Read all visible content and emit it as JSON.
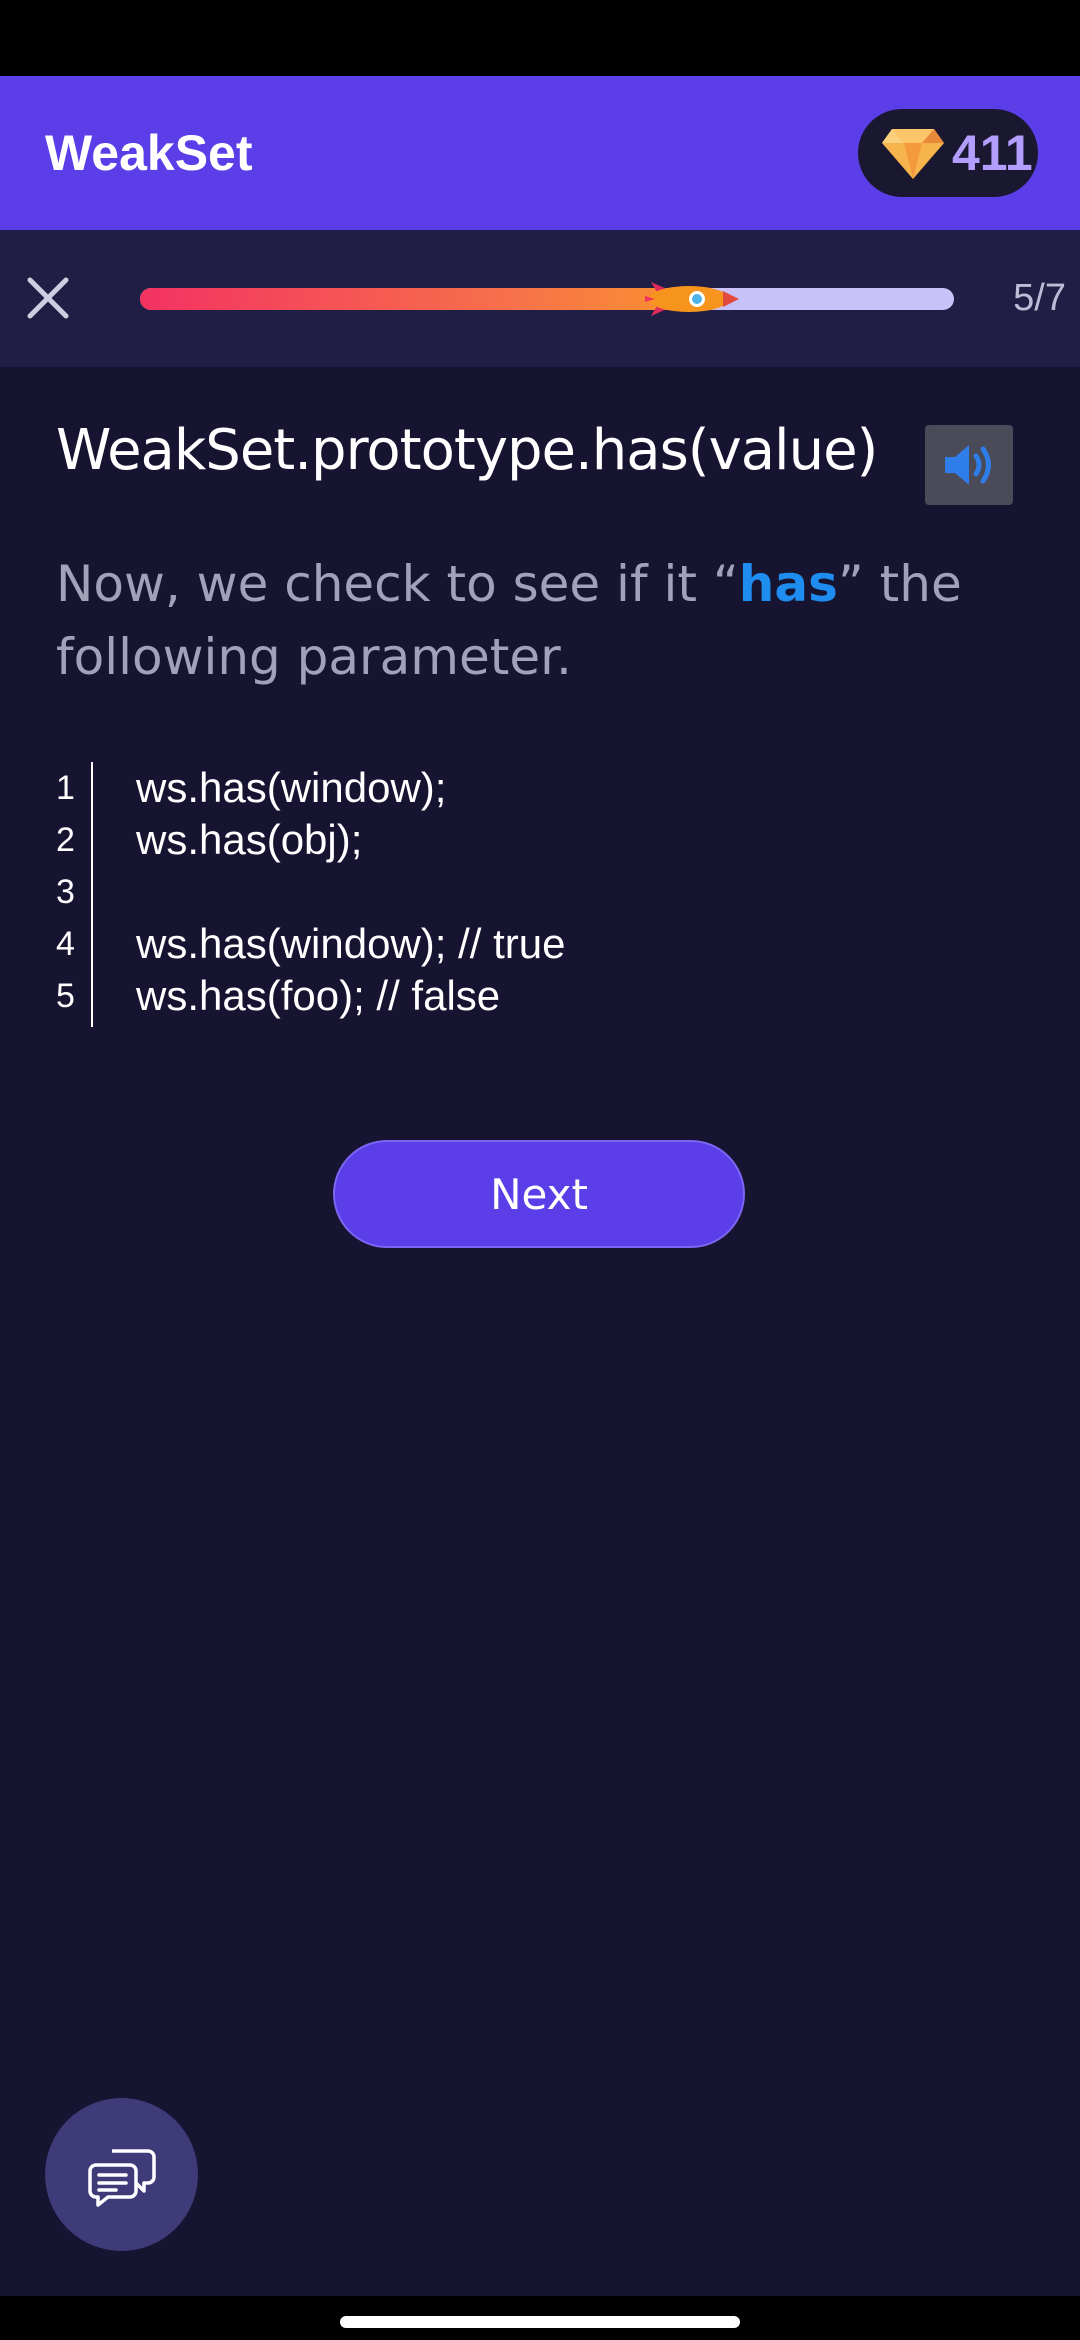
{
  "app_bar": {
    "title": "WeakSet",
    "gems": {
      "icon": "diamond-icon",
      "count": "411"
    }
  },
  "progress": {
    "close_icon": "close-icon",
    "current": 5,
    "total": 7,
    "fraction": 0.714,
    "label": "5/7",
    "marker_icon": "rocket-icon"
  },
  "lesson": {
    "title": "WeakSet.prototype.has(value)",
    "speaker_icon": "speaker-icon",
    "text_before": "Now, we check to see if it “",
    "text_highlight": "has",
    "text_after": "” the following parameter."
  },
  "code": {
    "lines": [
      {
        "no": "1",
        "text": "ws.has(window);"
      },
      {
        "no": "2",
        "text": "ws.has(obj);"
      },
      {
        "no": "3",
        "text": ""
      },
      {
        "no": "4",
        "text": "ws.has(window); // true"
      },
      {
        "no": "5",
        "text": "ws.has(foo); // false"
      }
    ]
  },
  "actions": {
    "next_label": "Next",
    "chat_icon": "chat-icon"
  },
  "colors": {
    "app_bar": "#5b3ee8",
    "background": "#161430",
    "highlight": "#1f8df0"
  }
}
